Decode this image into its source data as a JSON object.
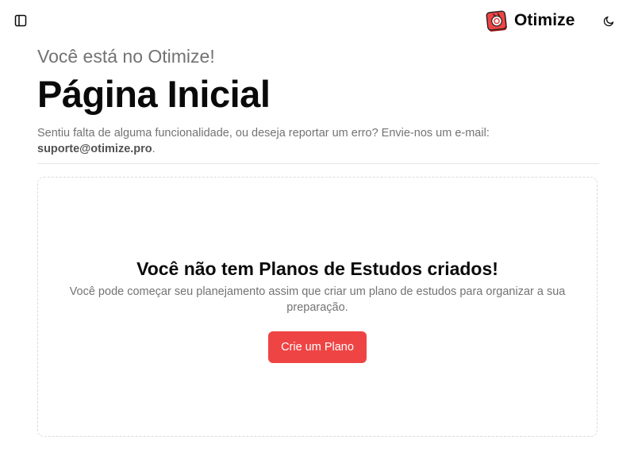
{
  "app": {
    "brand_name": "Otimize",
    "brand_color": "#ef4444"
  },
  "header": {
    "subtitle": "Você está no Otimize!",
    "title": "Página Inicial",
    "support_text": "Sentiu falta de alguma funcionalidade, ou deseja reportar um erro? Envie-nos um e-mail:",
    "support_email": "suporte@otimize.pro",
    "support_suffix": "."
  },
  "empty_state": {
    "title": "Você não tem Planos de Estudos criados!",
    "description": "Você pode começar seu planejamento assim que criar um plano de estudos para organizar a sua preparação.",
    "button_label": "Crie um Plano",
    "button_color": "#ef4444"
  },
  "icons": {
    "sidebar_toggle": "panel-left-icon",
    "logo": "otimize-logo-icon",
    "theme_toggle": "moon-icon"
  }
}
